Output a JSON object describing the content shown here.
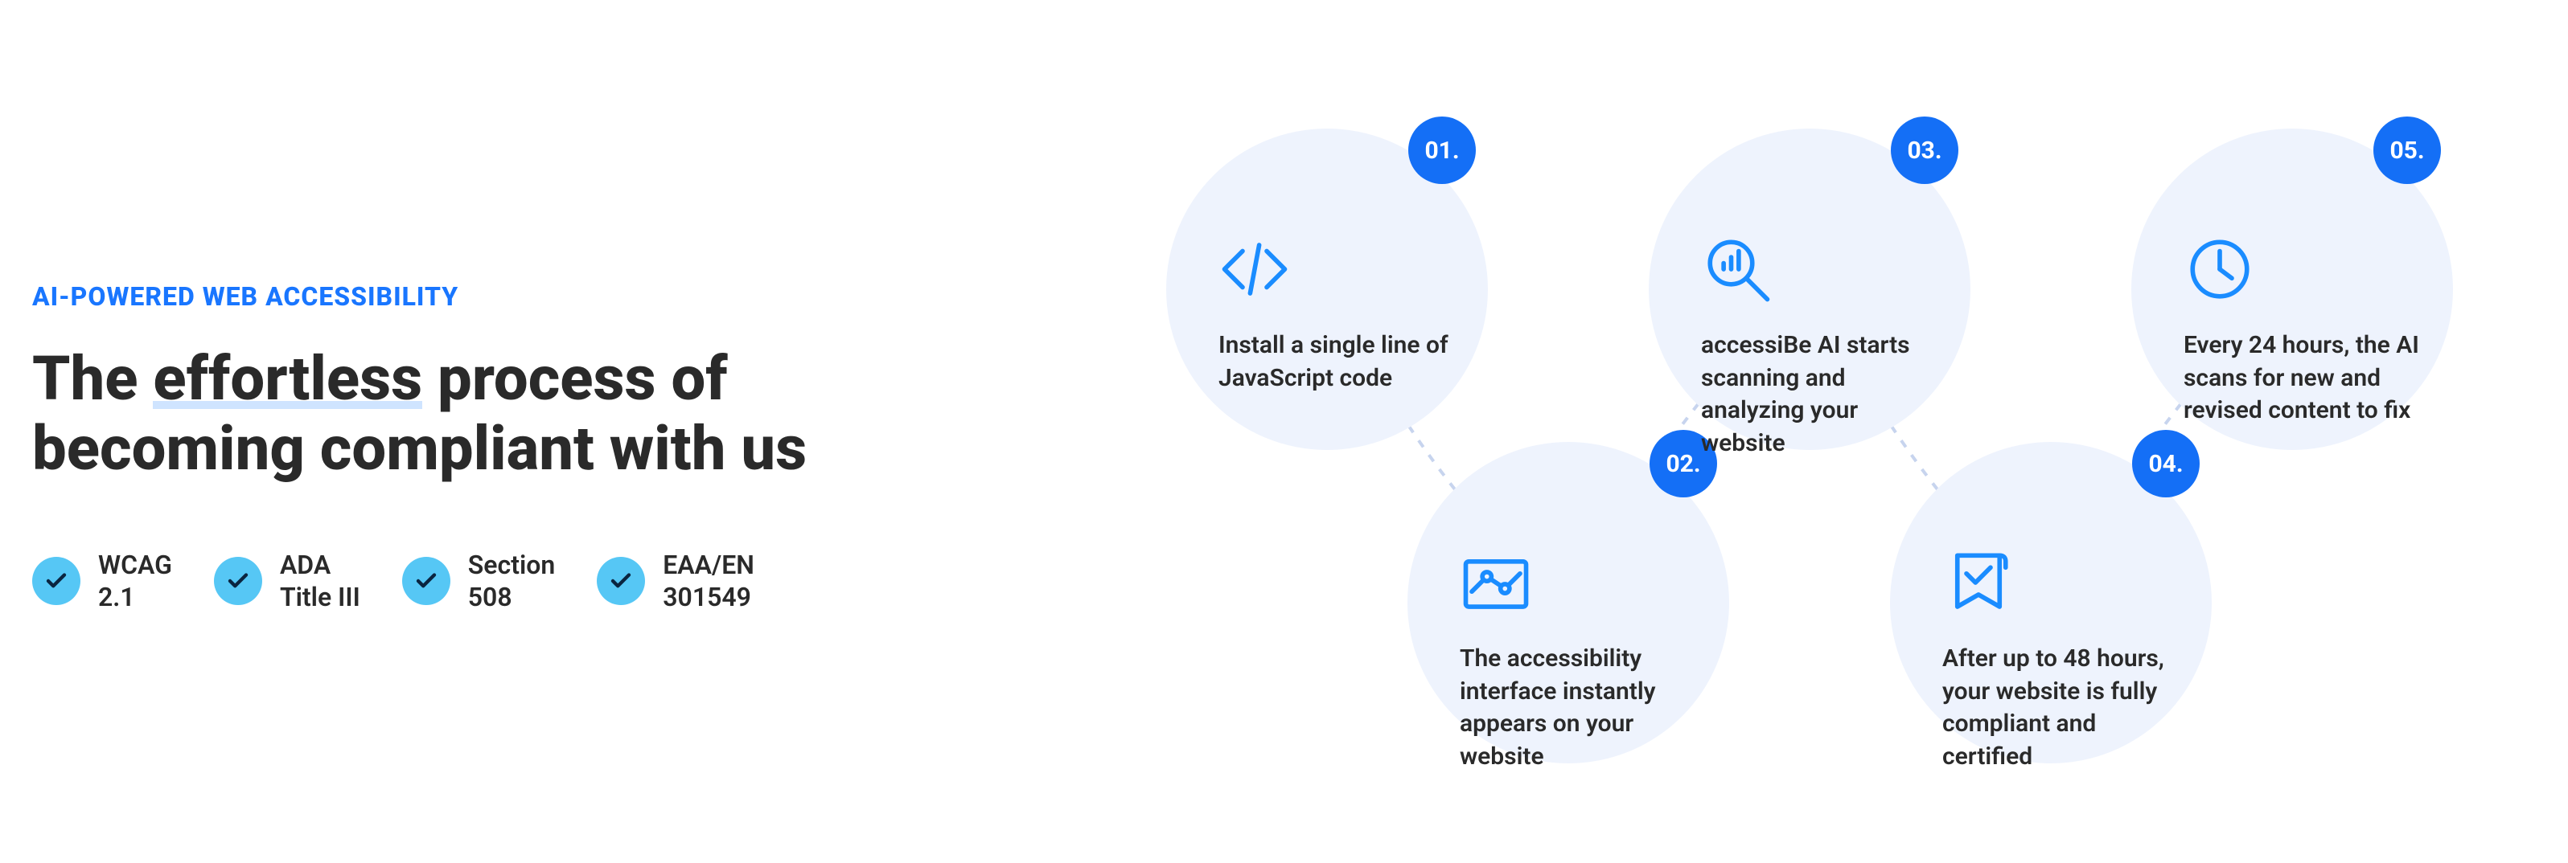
{
  "eyebrow": "AI-POWERED WEB ACCESSIBILITY",
  "headline_pre": "The ",
  "headline_underlined": "effortless",
  "headline_post": " process of becoming compliant with us",
  "compliance": [
    {
      "label": "WCAG\n2.1"
    },
    {
      "label": "ADA\nTitle III"
    },
    {
      "label": "Section\n508"
    },
    {
      "label": "EAA/EN\n301549"
    }
  ],
  "steps": [
    {
      "num": "01.",
      "desc": "Install a single line of JavaScript code"
    },
    {
      "num": "02.",
      "desc": "The accessibility interface instantly appears on your website"
    },
    {
      "num": "03.",
      "desc": "accessiBe AI starts scanning and analyzing your website"
    },
    {
      "num": "04.",
      "desc": "After up to 48 hours, your website is fully compliant and certified"
    },
    {
      "num": "05.",
      "desc": "Every 24 hours, the AI scans for new and revised content to fix"
    }
  ]
}
